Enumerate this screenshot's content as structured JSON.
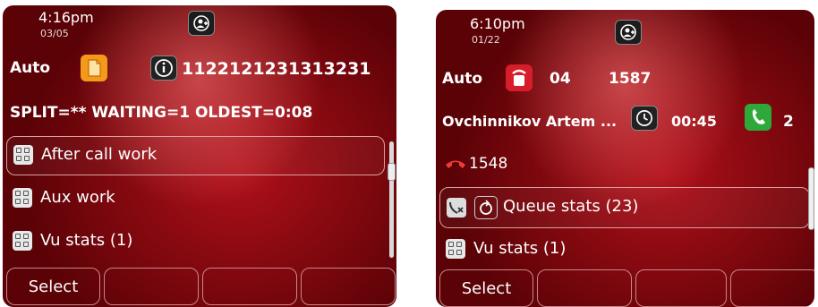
{
  "left": {
    "time": "4:16pm",
    "date": "03/05",
    "mode_label": "Auto",
    "caller_number": "1122121231313231",
    "status_line": "SPLIT=** WAITING=1  OLDEST=0:08",
    "menu_items": [
      {
        "label": "After call work",
        "selected": true
      },
      {
        "label": "Aux work",
        "selected": false
      },
      {
        "label": "Vu stats (1)",
        "selected": false
      }
    ],
    "softkeys": [
      "Select",
      "",
      "",
      ""
    ]
  },
  "right": {
    "time": "6:10pm",
    "date": "01/22",
    "mode_label": "Auto",
    "queue_count": "04",
    "extension": "1587",
    "agent_name": "Ovchinnikov Artem ...",
    "timer": "00:45",
    "active_calls": "2",
    "held_number": "1548",
    "queue_stats_label": "Queue stats (23)",
    "vu_stats_label": "Vu stats (1)",
    "softkeys": [
      "Select",
      "",
      "",
      ""
    ]
  },
  "colors": {
    "background_red": "#b0101a",
    "dark_red": "#5a0206",
    "orange_icon": "#f39a1a",
    "green_icon": "#2fa83a"
  }
}
